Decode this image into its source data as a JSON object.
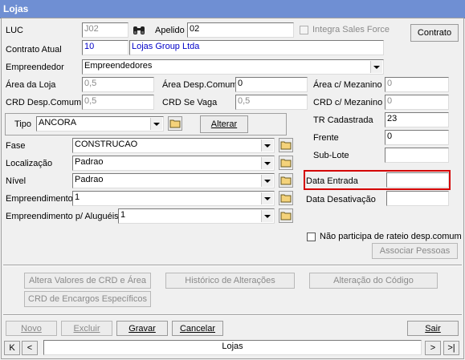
{
  "window": {
    "title": "Lojas"
  },
  "form": {
    "luc_label": "LUC",
    "luc_value": "J02",
    "apelido_label": "Apelido",
    "apelido_value": "02",
    "integra_label": "Integra Sales Force",
    "contrato_button": "Contrato",
    "contrato_atual_label": "Contrato Atual",
    "contrato_number": "10",
    "contrato_name": "Lojas Group Ltda",
    "empreendedor_label": "Empreendedor",
    "empreendedor_value": "Empreendedores",
    "area_loja_label": "Área da Loja",
    "area_loja_value": "0,5",
    "area_desp_label": "Área Desp.Comum",
    "area_desp_value": "0",
    "area_mezanino_label": "Área c/ Mezanino",
    "area_mezanino_value": "0",
    "crd_desp_label": "CRD Desp.Comum",
    "crd_desp_value": "0,5",
    "crd_vaga_label": "CRD Se Vaga",
    "crd_vaga_value": "0,5",
    "crd_mezanino_label": "CRD c/ Mezanino",
    "crd_mezanino_value": "0",
    "tipo_label": "Tipo",
    "tipo_value": "ANCORA",
    "alterar_button": "Alterar",
    "tr_label": "TR Cadastrada",
    "tr_value": "23",
    "frente_label": "Frente",
    "frente_value": "0",
    "sublote_label": "Sub-Lote",
    "sublote_value": "",
    "fase_label": "Fase",
    "fase_value": "CONSTRUCAO",
    "localizacao_label": "Localização",
    "localizacao_value": "Padrao",
    "nivel_label": "Nível",
    "nivel_value": "Padrao",
    "empreendimento_label": "Empreendimento",
    "empreendimento_value": "1",
    "empreendimento_alug_label": "Empreendimento p/ Aluguéis",
    "empreendimento_alug_value": "1",
    "data_entrada_label": "Data Entrada",
    "data_entrada_value": "",
    "data_desativacao_label": "Data Desativação",
    "data_desativacao_value": "",
    "rateio_label": "Não participa de rateio desp.comum",
    "associar_button": "Associar Pessoas"
  },
  "actions": {
    "altera_valores": "Altera Valores de CRD e Área",
    "historico": "Histórico de Alterações",
    "alteracao_codigo": "Alteração do Código",
    "crd_encargos": "CRD de Encargos Específicos"
  },
  "toolbar": {
    "novo": "Novo",
    "excluir": "Excluir",
    "gravar": "Gravar",
    "cancelar": "Cancelar",
    "sair": "Sair"
  },
  "nav": {
    "first": "K",
    "prev": "<",
    "label": "Lojas",
    "next": ">",
    "last": ">|"
  },
  "colors": {
    "titlebar": "#6f8fd3",
    "highlight": "#d40000",
    "link_blue": "#0000c8"
  }
}
